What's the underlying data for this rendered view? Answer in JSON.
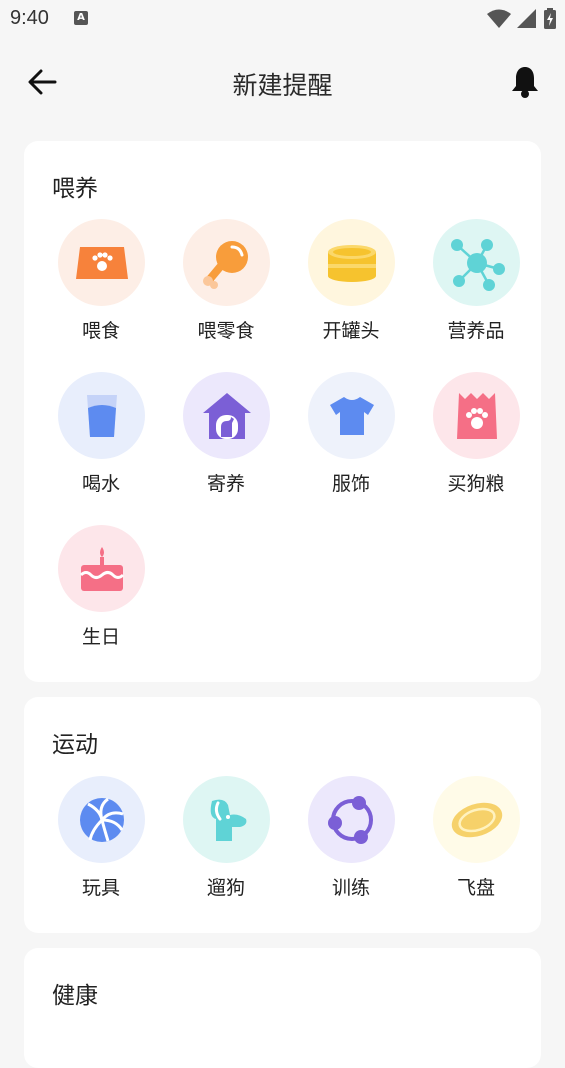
{
  "status_bar": {
    "time": "9:40",
    "notification_letter": "A"
  },
  "header": {
    "title": "新建提醒"
  },
  "sections": [
    {
      "title": "喂养",
      "items": [
        {
          "label": "喂食",
          "icon": "food-bowl-icon",
          "bg": "#fdeee6"
        },
        {
          "label": "喂零食",
          "icon": "drumstick-icon",
          "bg": "#fdeee6"
        },
        {
          "label": "开罐头",
          "icon": "can-icon",
          "bg": "#fff6de"
        },
        {
          "label": "营养品",
          "icon": "molecule-icon",
          "bg": "#def6f3"
        },
        {
          "label": "喝水",
          "icon": "water-glass-icon",
          "bg": "#e8eefc"
        },
        {
          "label": "寄养",
          "icon": "dog-house-icon",
          "bg": "#ece8fc"
        },
        {
          "label": "服饰",
          "icon": "tshirt-icon",
          "bg": "#eef2fb"
        },
        {
          "label": "买狗粮",
          "icon": "dog-food-bag-icon",
          "bg": "#fde6ea"
        },
        {
          "label": "生日",
          "icon": "birthday-cake-icon",
          "bg": "#fde6ea"
        }
      ]
    },
    {
      "title": "运动",
      "items": [
        {
          "label": "玩具",
          "icon": "volleyball-icon",
          "bg": "#e8eefc"
        },
        {
          "label": "遛狗",
          "icon": "dog-head-icon",
          "bg": "#def6f3"
        },
        {
          "label": "训练",
          "icon": "training-icon",
          "bg": "#ece8fc"
        },
        {
          "label": "飞盘",
          "icon": "frisbee-icon",
          "bg": "#fffbe8"
        }
      ]
    },
    {
      "title": "健康",
      "items": []
    }
  ]
}
